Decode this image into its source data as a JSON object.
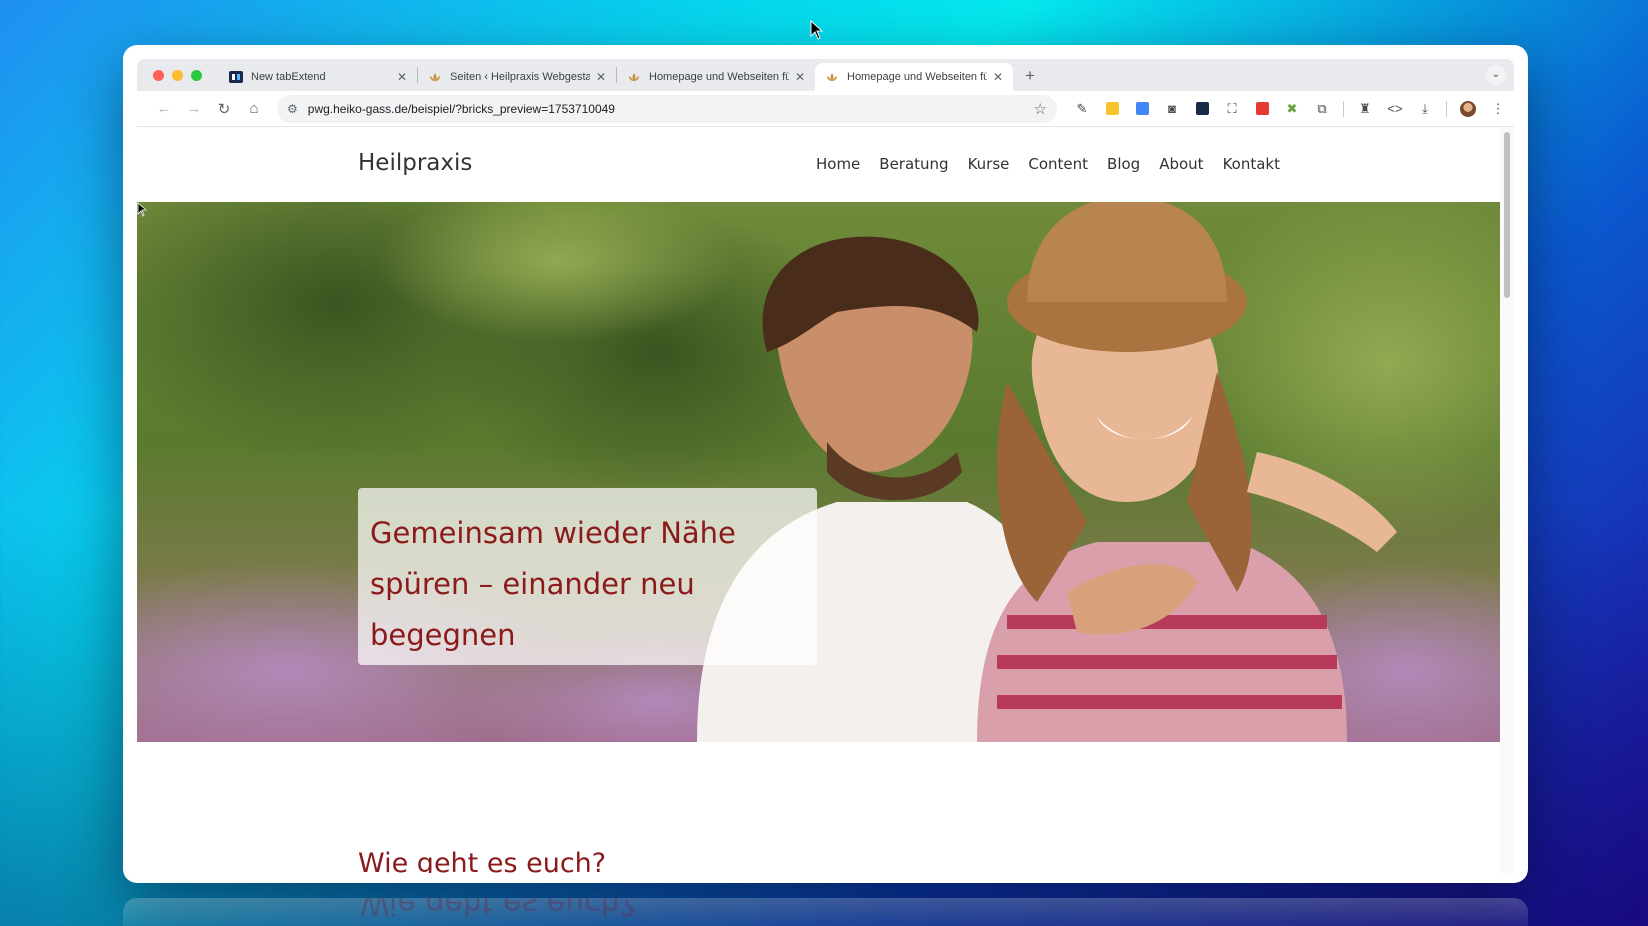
{
  "browser": {
    "tabs": [
      {
        "title": "New tabExtend",
        "active": false
      },
      {
        "title": "Seiten ‹ Heilpraxis Webgestal",
        "active": false
      },
      {
        "title": "Homepage und Webseiten für",
        "active": false
      },
      {
        "title": "Homepage und Webseiten für",
        "active": true
      }
    ],
    "new_tab_label": "+",
    "url": "pwg.heiko-gass.de/beispiel/?bricks_preview=1753710049"
  },
  "site": {
    "brand": "Heilpraxis",
    "menu": [
      "Home",
      "Beratung",
      "Kurse",
      "Content",
      "Blog",
      "About",
      "Kontakt"
    ],
    "hero_heading_lines": [
      "Gemeinsam wieder Nähe",
      "spüren – einander neu",
      "begegnen"
    ],
    "section_heading": "Wie geht es euch?"
  },
  "colors": {
    "accent": "#8b1a1a",
    "brand_text": "#333333"
  }
}
